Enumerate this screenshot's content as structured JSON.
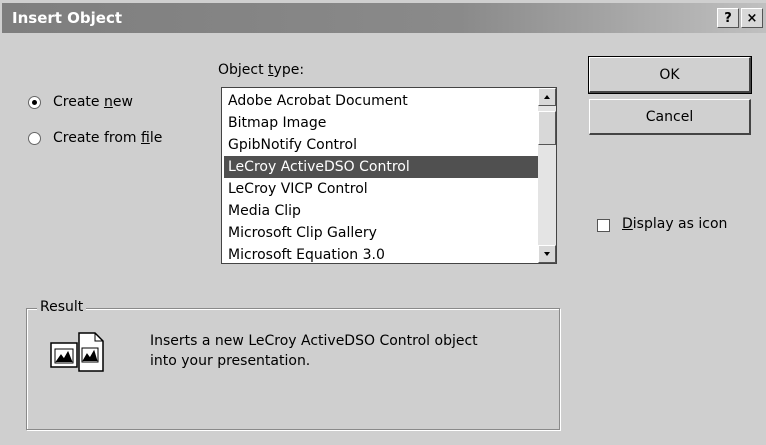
{
  "window": {
    "title": "Insert Object",
    "help_label": "?",
    "close_label": "×"
  },
  "options": {
    "create_new": {
      "pre": "Create ",
      "mnemonic": "n",
      "post": "ew",
      "selected": true
    },
    "create_from_file": {
      "pre": "Create from ",
      "mnemonic": "f",
      "post": "ile",
      "selected": false
    }
  },
  "object_type": {
    "label_pre": "Object ",
    "label_mnemonic": "t",
    "label_post": "ype:",
    "items": [
      "Adobe Acrobat Document",
      "Bitmap Image",
      "GpibNotify Control",
      "LeCroy ActiveDSO Control",
      "LeCroy VICP Control",
      "Media Clip",
      "Microsoft Clip Gallery",
      "Microsoft Equation 3.0"
    ],
    "selected_index": 3
  },
  "buttons": {
    "ok": "OK",
    "cancel": "Cancel"
  },
  "display_as_icon": {
    "mnemonic": "D",
    "post": "isplay as icon",
    "checked": false
  },
  "result": {
    "legend": "Result",
    "line1": "Inserts a new LeCroy ActiveDSO Control object",
    "line2": "into your presentation."
  }
}
